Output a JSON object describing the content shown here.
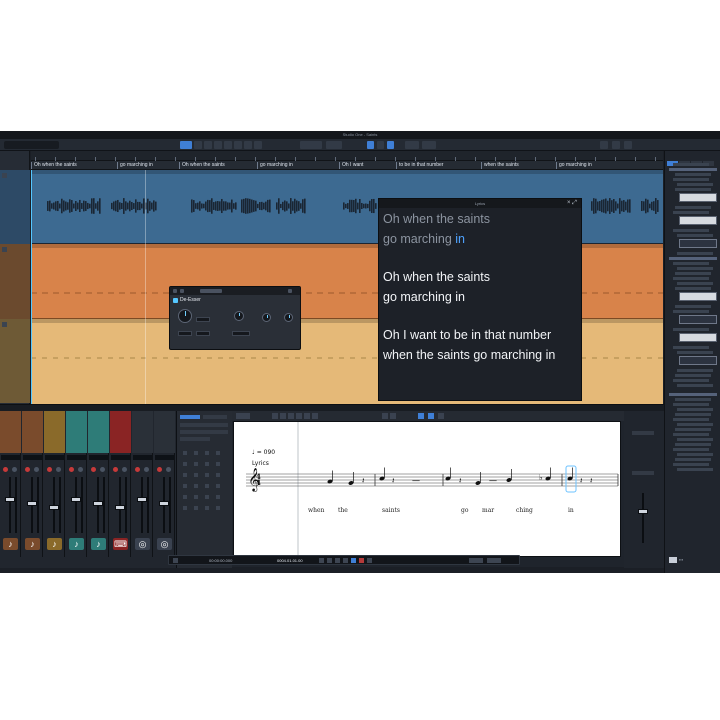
{
  "window": {
    "title": "Studio One - Saints"
  },
  "lyric_track": {
    "chips": [
      "Oh when the saints",
      "go marching in",
      "Oh when the saints",
      "go marching in",
      "Oh I want",
      "to be in that number",
      "when the saints",
      "go marching in"
    ]
  },
  "plugin": {
    "name": "De-Esser"
  },
  "lyrics_window": {
    "title": "Lyrics",
    "lines": [
      {
        "text": "Oh when the saints",
        "state": "past"
      },
      {
        "text_before": "go marching ",
        "text_highlight": "in",
        "state": "current"
      },
      {
        "text": "Oh when the saints",
        "state": "upcoming"
      },
      {
        "text": "go marching in",
        "state": "upcoming"
      },
      {
        "text": "Oh I want to be in that number",
        "state": "upcoming"
      },
      {
        "text": "when the saints go marching in",
        "state": "upcoming"
      }
    ]
  },
  "score": {
    "tempo_label": "= 090",
    "staff_label": "Lyrics",
    "time_signature": {
      "top": "4",
      "bottom": "4"
    },
    "lyrics": [
      "when",
      "the",
      "saints",
      "go",
      "mar",
      "ching",
      "in"
    ]
  },
  "transport": {
    "position": "00:00:00.000",
    "bars": "0004.01.01.00"
  },
  "colors": {
    "vocal_lane": "#3d6a91",
    "orange_lane": "#d8834a",
    "sand_lane": "#e5b978",
    "accent": "#3f7fd6",
    "lyric_highlight": "#4fa3ff"
  },
  "mixer": {
    "channels": [
      {
        "color": "#7a4b2c",
        "icon": "guitar-icon"
      },
      {
        "color": "#7a4b2c",
        "icon": "guitar-icon"
      },
      {
        "color": "#8a6a2a",
        "icon": "guitar-icon"
      },
      {
        "color": "#2e7c78",
        "icon": "guitar-icon"
      },
      {
        "color": "#2e7c78",
        "icon": "guitar-icon"
      },
      {
        "color": "#8a2424",
        "icon": "keyboard-icon"
      },
      {
        "color": "#2a3038",
        "icon": "drums-icon"
      },
      {
        "color": "#2a3038",
        "icon": "drums-icon"
      }
    ]
  }
}
